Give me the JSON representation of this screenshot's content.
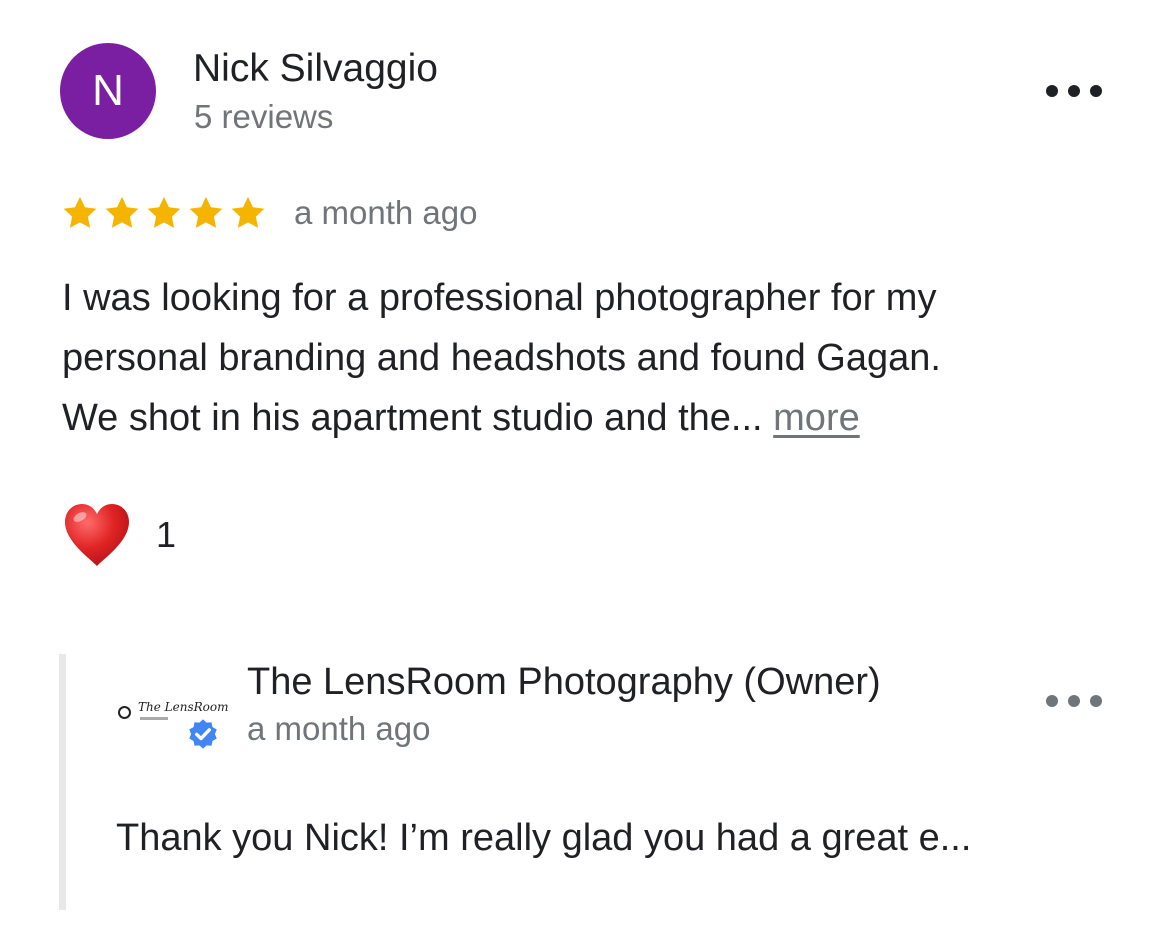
{
  "review": {
    "avatar_letter": "N",
    "avatar_color": "#7b1fa2",
    "reviewer_name": "Nick Silvaggio",
    "review_count": "5 reviews",
    "rating": 5,
    "rating_max": 5,
    "star_color": "#f4b400",
    "time": "a month ago",
    "text_lines": [
      "I was looking for a professional photographer for my",
      "personal branding and headshots and found Gagan.",
      "We shot in his apartment studio and the... "
    ],
    "more_label": "more",
    "reaction": {
      "icon": "heart-icon",
      "count": "1"
    },
    "menu_icon": "more-horizontal-icon"
  },
  "owner_response": {
    "logo_text": "The LensRoom",
    "owner_name": "The LensRoom Photography (Owner)",
    "time": "a month ago",
    "text": "Thank you Nick! I’m really glad you had a great e...",
    "verified_icon": "verified-badge-icon",
    "verified_color": "#4285f4",
    "menu_icon": "more-horizontal-icon"
  }
}
